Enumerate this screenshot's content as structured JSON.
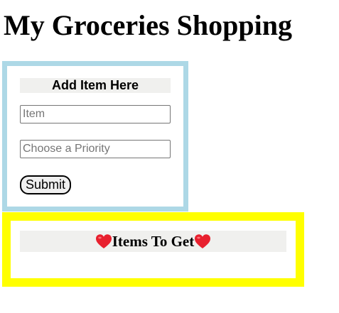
{
  "page": {
    "title": "My Groceries Shopping"
  },
  "add_form": {
    "heading": "Add Item Here",
    "item_placeholder": "Item",
    "item_value": "",
    "priority_placeholder": "Choose a Priority",
    "priority_value": "",
    "submit_label": "Submit"
  },
  "items_list": {
    "heading": "Items To Get",
    "heading_icons": [
      "heart-icon",
      "heart-icon"
    ],
    "items": []
  },
  "colors": {
    "add_panel_border": "#add8e6",
    "items_panel_border": "#ffff00",
    "heading_background": "#f0f0ee",
    "heart": "#e8202e"
  }
}
